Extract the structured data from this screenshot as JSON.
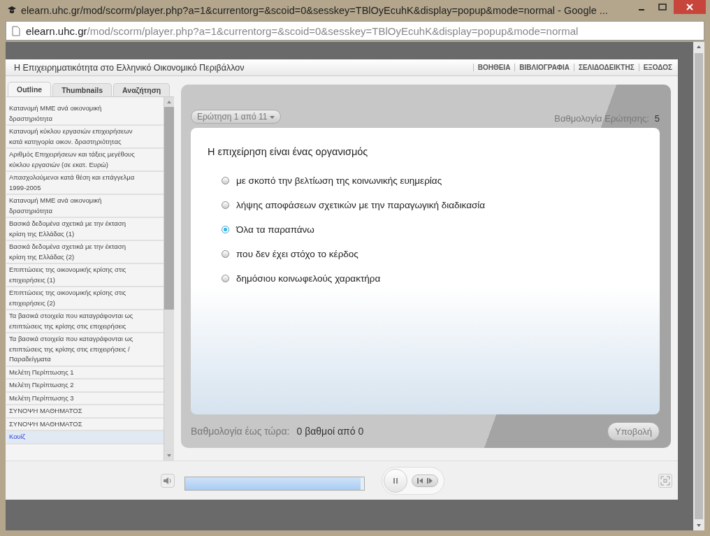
{
  "window": {
    "title": "elearn.uhc.gr/mod/scorm/player.php?a=1&currentorg=&scoid=0&sesskey=TBlOyEcuhK&display=popup&mode=normal - Google ..."
  },
  "address_bar": {
    "host": "elearn.uhc.gr",
    "path": "/mod/scorm/player.php?a=1&currentorg=&scoid=0&sesskey=TBlOyEcuhK&display=popup&mode=normal"
  },
  "player": {
    "title": "Η Επιχειρηματικότητα στο Ελληνικό Οικονομικό Περιβάλλον",
    "links": [
      "ΒΟΗΘΕΙΑ",
      "ΒΙΒΛΙΟΓΡΑΦΙΑ",
      "ΣΕΛΙΔΟΔΕΙΚΤΗΣ",
      "ΕΞΟΔΟΣ"
    ]
  },
  "tabs": [
    {
      "label": "Outline",
      "selected": true
    },
    {
      "label": "Thumbnails",
      "selected": false
    },
    {
      "label": "Αναζήτηση",
      "selected": false
    }
  ],
  "outline": [
    {
      "label": "Κατανομή ΜΜΕ ανά οικονομική δραστηριότητα",
      "selected": false
    },
    {
      "label": "Κατανομή κύκλου εργασιών επιχειρήσεων κατά κατηγορία οικον. δραστηριότητας",
      "selected": false
    },
    {
      "label": "Αριθμός Επιχειρήσεων και τάξεις μεγέθους κύκλου εργασιών (σε εκατ. Ευρώ)",
      "selected": false
    },
    {
      "label": "Απασχολούμενοι κατά θέση και επάγγελμα 1999-2005",
      "selected": false
    },
    {
      "label": "Κατανομή ΜΜΕ ανά οικονομική δραστηριότητα",
      "selected": false
    },
    {
      "label": "Βασικά δεδομένα σχετικά με την έκταση κρίση της Ελλάδας (1)",
      "selected": false
    },
    {
      "label": "Βασικά δεδομένα σχετικά με την έκταση κρίση της Ελλάδας (2)",
      "selected": false
    },
    {
      "label": "Επιπτώσεις της οικονομικής κρίσης στις επιχειρήσεις (1)",
      "selected": false
    },
    {
      "label": "Επιπτώσεις της οικονομικής κρίσης στις επιχειρήσεις (2)",
      "selected": false
    },
    {
      "label": "Τα βασικά στοιχεία που καταγράφονται ως επιπτώσεις της κρίσης στις επιχειρήσεις",
      "selected": false
    },
    {
      "label": "Τα βασικά στοιχεία που καταγράφονται ως επιπτώσεις της κρίσης στις επιχειρήσεις /Παραδείγματα",
      "selected": false
    },
    {
      "label": "Μελέτη Περίπτωσης 1",
      "selected": false
    },
    {
      "label": "Μελέτη Περίπτωσης 2",
      "selected": false
    },
    {
      "label": "Μελέτη Περίπτωσης 3",
      "selected": false
    },
    {
      "label": "ΣΥΝΟΨΗ ΜΑΘΗΜΑΤΟΣ",
      "selected": false
    },
    {
      "label": "ΣΥΝΟΨΗ ΜΑΘΗΜΑΤΟΣ",
      "selected": false
    },
    {
      "label": "Κουίζ",
      "selected": true
    }
  ],
  "quiz": {
    "question_selector": "Ερώτηση 1 από 11",
    "points_label": "Βαθμολογία Ερώτησης:",
    "points": "5",
    "question": "Η επιχείρηση είναι ένας οργανισμός",
    "options": [
      {
        "label": "με σκοπό την βελτίωση της κοινωνικής ευημερίας",
        "selected": false
      },
      {
        "label": "λήψης αποφάσεων σχετικών με την παραγωγική διαδικασία",
        "selected": false
      },
      {
        "label": "Όλα τα παραπάνω",
        "selected": true
      },
      {
        "label": "που δεν έχει στόχο το κέρδος",
        "selected": false
      },
      {
        "label": "δημόσιου κοινωφελούς χαρακτήρα",
        "selected": false
      }
    ],
    "score_label": "Βαθμολογία έως τώρα:",
    "score": "0 βαθμοί από 0",
    "submit": "Υποβολή"
  },
  "playback": {
    "level": 0.98
  }
}
